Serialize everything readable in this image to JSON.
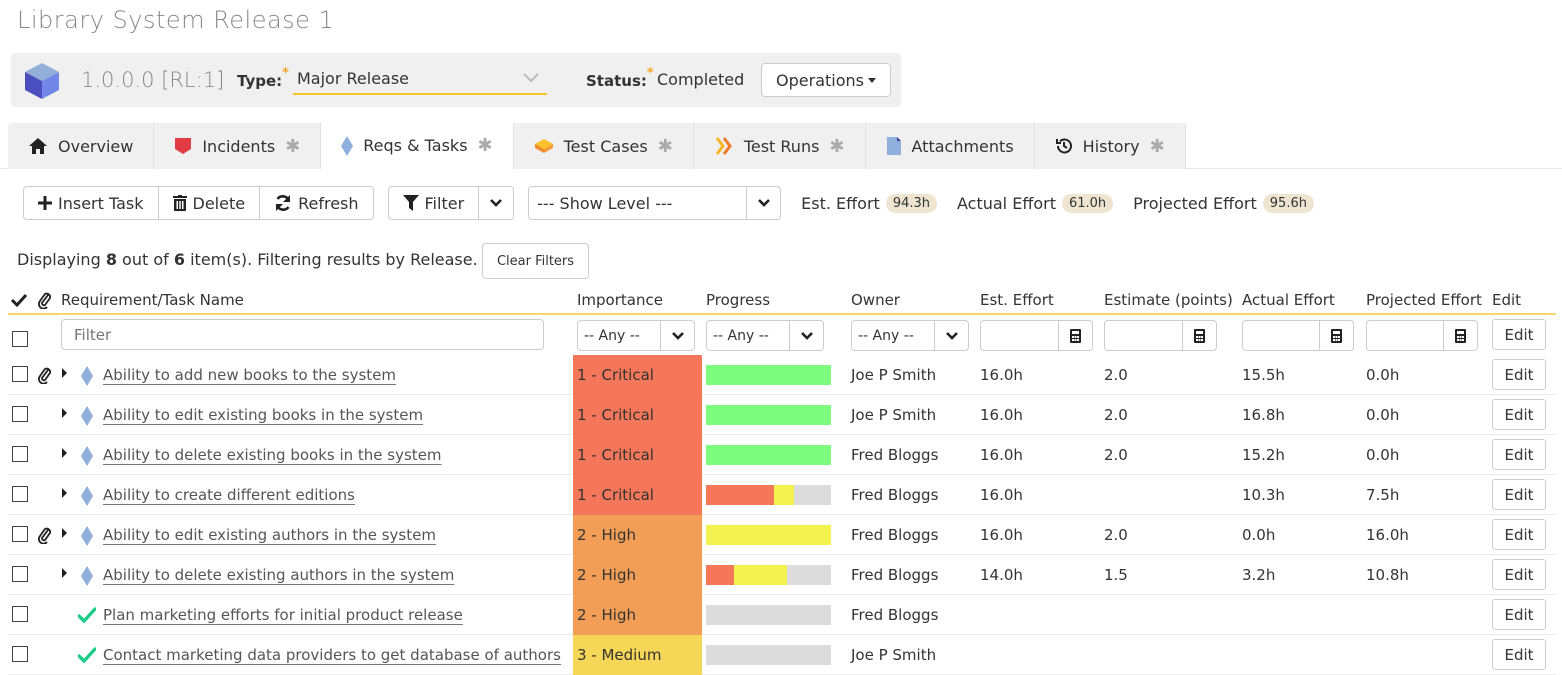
{
  "page": {
    "title": "Library System Release 1"
  },
  "header": {
    "release_id": "1.0.0.0 [RL:1]",
    "type_label": "Type:",
    "type_value": "Major Release",
    "status_label": "Status:",
    "status_value": "Completed",
    "operations_label": "Operations",
    "required_marker": "*"
  },
  "tabs": [
    {
      "label": "Overview",
      "icon": "home-icon",
      "has_star": false
    },
    {
      "label": "Incidents",
      "icon": "incident-shield-icon",
      "has_star": true
    },
    {
      "label": "Reqs & Tasks",
      "icon": "requirement-diamond-icon",
      "has_star": true,
      "active": true
    },
    {
      "label": "Test Cases",
      "icon": "test-case-icon",
      "has_star": true
    },
    {
      "label": "Test Runs",
      "icon": "test-run-chevrons-icon",
      "has_star": true
    },
    {
      "label": "Attachments",
      "icon": "document-icon",
      "has_star": false
    },
    {
      "label": "History",
      "icon": "history-icon",
      "has_star": true
    }
  ],
  "tab_star": "✱",
  "toolbar": {
    "insert_task": "Insert Task",
    "delete": "Delete",
    "refresh": "Refresh",
    "filter": "Filter",
    "show_level": "--- Show Level ---",
    "est_effort_label": "Est. Effort",
    "est_effort_value": "94.3h",
    "actual_effort_label": "Actual Effort",
    "actual_effort_value": "61.0h",
    "projected_effort_label": "Projected Effort",
    "projected_effort_value": "95.6h"
  },
  "display": {
    "prefix": "Displaying",
    "shown": "8",
    "middle": "out of",
    "total": "6",
    "suffix": "item(s). Filtering results by Release.",
    "clear_filters": "Clear Filters"
  },
  "grid": {
    "columns": {
      "name": "Requirement/Task Name",
      "importance": "Importance",
      "progress": "Progress",
      "owner": "Owner",
      "est_effort": "Est. Effort",
      "estimate_points": "Estimate (points)",
      "actual_effort": "Actual Effort",
      "projected_effort": "Projected Effort",
      "edit": "Edit"
    },
    "filters": {
      "name_placeholder": "Filter",
      "importance": "-- Any --",
      "progress": "-- Any --",
      "owner": "-- Any --",
      "edit": "Edit"
    },
    "importance_colors": {
      "1 - Critical": "#f4775a",
      "2 - High": "#f29e57",
      "3 - Medium": "#f5d657"
    },
    "progress_colors": {
      "red": "#f4775a",
      "yellow": "#f2f250",
      "green": "#7dfc7d",
      "empty": "#dcdcdc"
    },
    "rows": [
      {
        "type": "requirement",
        "attachment": true,
        "name": "Ability to add new books to the system",
        "importance": "1 - Critical",
        "progress": {
          "green": 1.0,
          "red": 0,
          "yellow": 0
        },
        "owner": "Joe P Smith",
        "est_effort": "16.0h",
        "estimate_points": "2.0",
        "actual_effort": "15.5h",
        "projected_effort": "0.0h",
        "edit": "Edit"
      },
      {
        "type": "requirement",
        "attachment": false,
        "name": "Ability to edit existing books in the system",
        "importance": "1 - Critical",
        "progress": {
          "green": 1.0,
          "red": 0,
          "yellow": 0
        },
        "owner": "Joe P Smith",
        "est_effort": "16.0h",
        "estimate_points": "2.0",
        "actual_effort": "16.8h",
        "projected_effort": "0.0h",
        "edit": "Edit"
      },
      {
        "type": "requirement",
        "attachment": false,
        "name": "Ability to delete existing books in the system",
        "importance": "1 - Critical",
        "progress": {
          "green": 1.0,
          "red": 0,
          "yellow": 0
        },
        "owner": "Fred Bloggs",
        "est_effort": "16.0h",
        "estimate_points": "2.0",
        "actual_effort": "15.2h",
        "projected_effort": "0.0h",
        "edit": "Edit"
      },
      {
        "type": "requirement",
        "attachment": false,
        "name": "Ability to create different editions",
        "importance": "1 - Critical",
        "progress": {
          "green": 0,
          "red": 0.54,
          "yellow": 0.16
        },
        "owner": "Fred Bloggs",
        "est_effort": "16.0h",
        "estimate_points": "",
        "actual_effort": "10.3h",
        "projected_effort": "7.5h",
        "edit": "Edit"
      },
      {
        "type": "requirement",
        "attachment": true,
        "name": "Ability to edit existing authors in the system",
        "importance": "2 - High",
        "progress": {
          "green": 0,
          "red": 0,
          "yellow": 1.0
        },
        "owner": "Fred Bloggs",
        "est_effort": "16.0h",
        "estimate_points": "2.0",
        "actual_effort": "0.0h",
        "projected_effort": "16.0h",
        "edit": "Edit"
      },
      {
        "type": "requirement",
        "attachment": false,
        "name": "Ability to delete existing authors in the system",
        "importance": "2 - High",
        "progress": {
          "green": 0,
          "red": 0.22,
          "yellow": 0.43
        },
        "owner": "Fred Bloggs",
        "est_effort": "14.0h",
        "estimate_points": "1.5",
        "actual_effort": "3.2h",
        "projected_effort": "10.8h",
        "edit": "Edit"
      },
      {
        "type": "task",
        "attachment": false,
        "name": "Plan marketing efforts for initial product release",
        "importance": "2 - High",
        "progress": {
          "green": 0,
          "red": 0,
          "yellow": 0
        },
        "owner": "Fred Bloggs",
        "est_effort": "",
        "estimate_points": "",
        "actual_effort": "",
        "projected_effort": "",
        "edit": "Edit"
      },
      {
        "type": "task",
        "attachment": false,
        "name": "Contact marketing data providers to get database of authors",
        "importance": "3 - Medium",
        "progress": {
          "green": 0,
          "red": 0,
          "yellow": 0
        },
        "owner": "Joe P Smith",
        "est_effort": "",
        "estimate_points": "",
        "actual_effort": "",
        "projected_effort": "",
        "edit": "Edit"
      }
    ]
  }
}
